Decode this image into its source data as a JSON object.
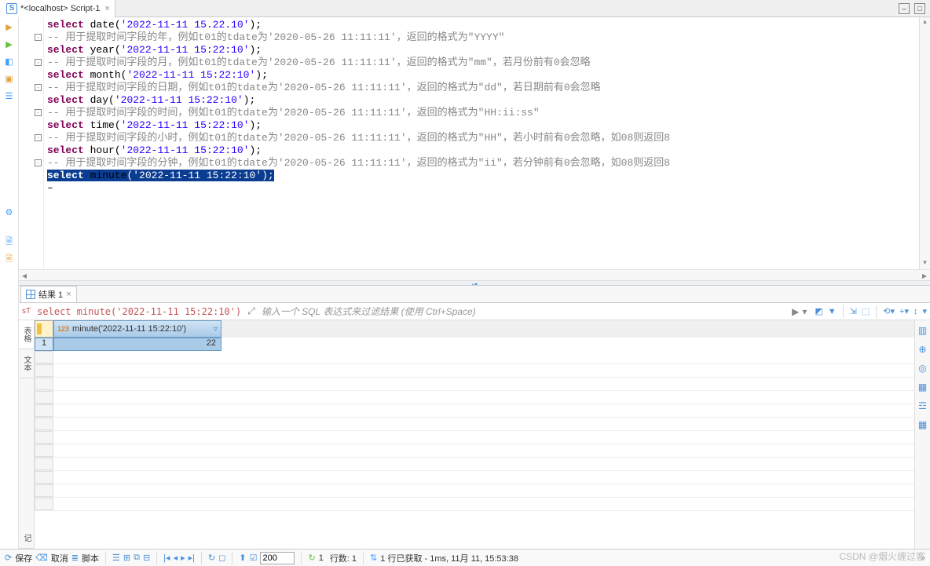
{
  "tab": {
    "title": "*<localhost> Script-1"
  },
  "code": {
    "lines": [
      {
        "type": "sql",
        "prefix": "select ",
        "func": "date",
        "arg": "'2022-11-11 15.22.10'",
        "suffix": ");",
        "fold": false
      },
      {
        "type": "cmt",
        "text": "-- 用于提取时间字段的年，例如t01的tdate为'2020-05-26 11:11:11'，返回的格式为\"YYYY\"",
        "fold": true
      },
      {
        "type": "sql",
        "prefix": "select ",
        "func": "year",
        "arg": "'2022-11-11 15:22:10'",
        "suffix": ");",
        "fold": false
      },
      {
        "type": "cmt",
        "text": "-- 用于提取时间字段的月，例如t01的tdate为'2020-05-26 11:11:11'，返回的格式为\"mm\"，若月份前有0会忽略",
        "fold": true
      },
      {
        "type": "sql",
        "prefix": "select ",
        "func": "month",
        "arg": "'2022-11-11 15:22:10'",
        "suffix": ");",
        "fold": false
      },
      {
        "type": "cmt",
        "text": "-- 用于提取时间字段的日期，例如t01的tdate为'2020-05-26 11:11:11'，返回的格式为\"dd\"，若日期前有0会忽略",
        "fold": true
      },
      {
        "type": "sql",
        "prefix": "select ",
        "func": "day",
        "arg": "'2022-11-11 15:22:10'",
        "suffix": ");",
        "fold": false
      },
      {
        "type": "cmt",
        "text": "-- 用于提取时间字段的时间，例如t01的tdate为'2020-05-26 11:11:11'，返回的格式为\"HH:ii:ss\"",
        "fold": true
      },
      {
        "type": "sql",
        "prefix": "select ",
        "func": "time",
        "arg": "'2022-11-11 15:22:10'",
        "suffix": ");",
        "fold": false
      },
      {
        "type": "cmt",
        "text": "-- 用于提取时间字段的小时，例如t01的tdate为'2020-05-26 11:11:11'，返回的格式为\"HH\"，若小时前有0会忽略，如08则返回8",
        "fold": true
      },
      {
        "type": "sql",
        "prefix": "select ",
        "func": "hour",
        "arg": "'2022-11-11 15:22:10'",
        "suffix": ");",
        "fold": false
      },
      {
        "type": "cmt",
        "text": "-- 用于提取时间字段的分钟，例如t01的tdate为'2020-05-26 11:11:11'，返回的格式为\"ii\"，若分钟前有0会忽略，如08则返回8",
        "fold": true
      },
      {
        "type": "sql",
        "prefix": "select ",
        "func": "minute",
        "arg": "'2022-11-11 15:22:10'",
        "suffix": ");",
        "fold": false,
        "selected": true
      }
    ]
  },
  "results": {
    "tabLabel": "结果 1",
    "queryLabel": "select minute('2022-11-11 15:22:10')",
    "filterPlaceholder": "输入一个 SQL 表达式来过滤结果 (使用 Ctrl+Space)",
    "columnHeader": "minute('2022-11-11 15:22:10')",
    "rowNum": "1",
    "cellValue": "22",
    "leftViews": [
      "表格",
      "文本",
      "记"
    ]
  },
  "status": {
    "save": "保存",
    "cancel": "取消",
    "script": "脚本",
    "pageSize": "200",
    "refresh": "1",
    "rows": "行数: 1",
    "fetched": "1 行已获取 - 1ms, 11月 11, 15:53:38"
  },
  "watermark": "CSDN @烟火缠过客"
}
